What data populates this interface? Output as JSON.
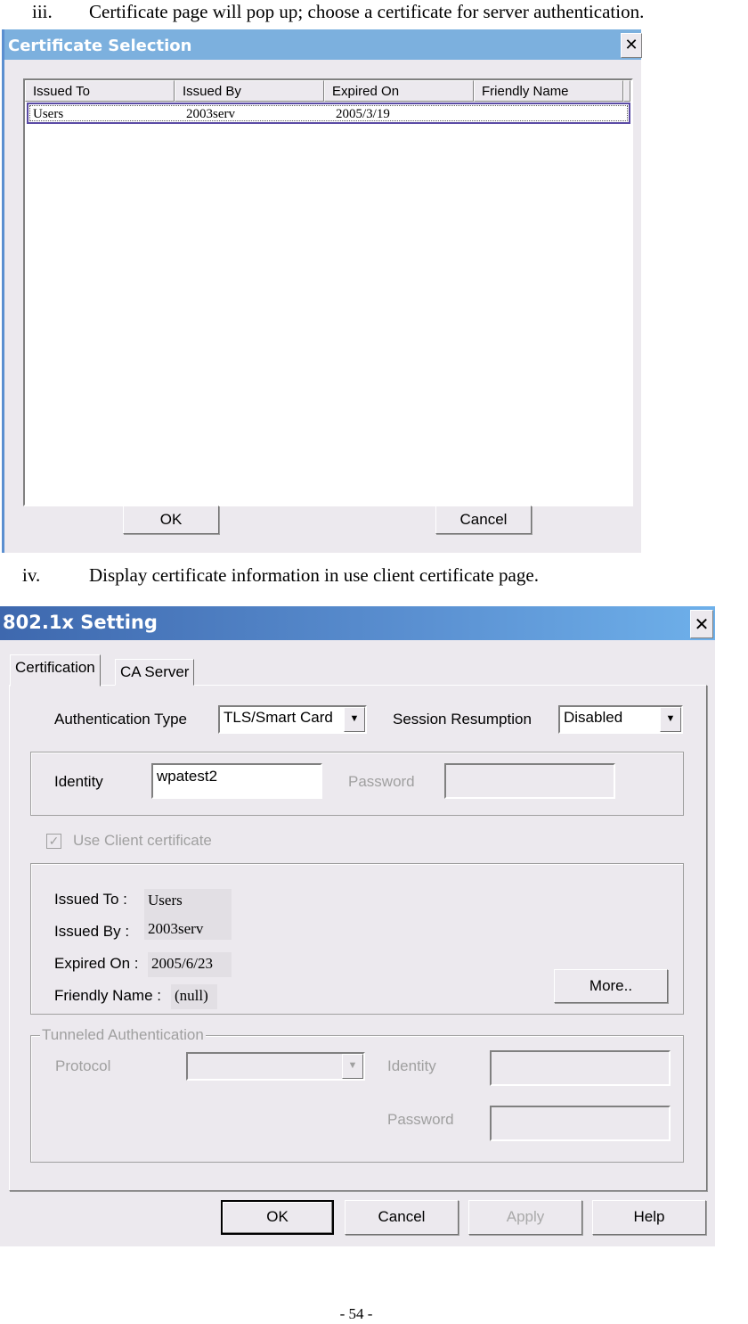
{
  "doc": {
    "step3": {
      "num": "iii.",
      "text": "Certificate page will pop up; choose a certificate for server authentication."
    },
    "step4": {
      "num": "iv.",
      "text": "Display certificate information in use client certificate page."
    },
    "page_number": "- 54 -"
  },
  "cert_selection": {
    "title": "Certificate Selection",
    "close_glyph": "✕",
    "columns": [
      "Issued To",
      "Issued By",
      "Expired On",
      "Friendly Name"
    ],
    "rows": [
      {
        "issued_to": "Users",
        "issued_by": "2003serv",
        "expired_on": "2005/3/19",
        "friendly_name": "",
        "selected": true
      }
    ],
    "ok_label": "OK",
    "cancel_label": "Cancel"
  },
  "setting": {
    "title": "802.1x Setting",
    "close_glyph": "✕",
    "tabs": [
      {
        "label": "Certification",
        "active": true
      },
      {
        "label": "CA Server",
        "active": false
      }
    ],
    "auth_type_label": "Authentication Type",
    "auth_type_value": "TLS/Smart Card",
    "session_resumption_label": "Session Resumption",
    "session_resumption_value": "Disabled",
    "identity_label": "Identity",
    "identity_value": "wpatest2",
    "password_label": "Password",
    "password_value": "",
    "use_client_cert_label": "Use Client certificate",
    "use_client_cert_checked": true,
    "cert_info": {
      "issued_to_label": "Issued To :",
      "issued_to": "Users",
      "issued_by_label": "Issued By :",
      "issued_by": "2003serv",
      "expired_on_label": "Expired On :",
      "expired_on": "2005/6/23",
      "friendly_name_label": "Friendly Name :",
      "friendly_name": "(null)",
      "more_label": "More.."
    },
    "tunneled": {
      "legend": "Tunneled Authentication",
      "protocol_label": "Protocol",
      "protocol_value": "",
      "identity_label": "Identity",
      "identity_value": "",
      "password_label": "Password",
      "password_value": ""
    },
    "buttons": {
      "ok": "OK",
      "cancel": "Cancel",
      "apply": "Apply",
      "help": "Help"
    },
    "dropdown_glyph": "▼",
    "check_glyph": "✓"
  }
}
